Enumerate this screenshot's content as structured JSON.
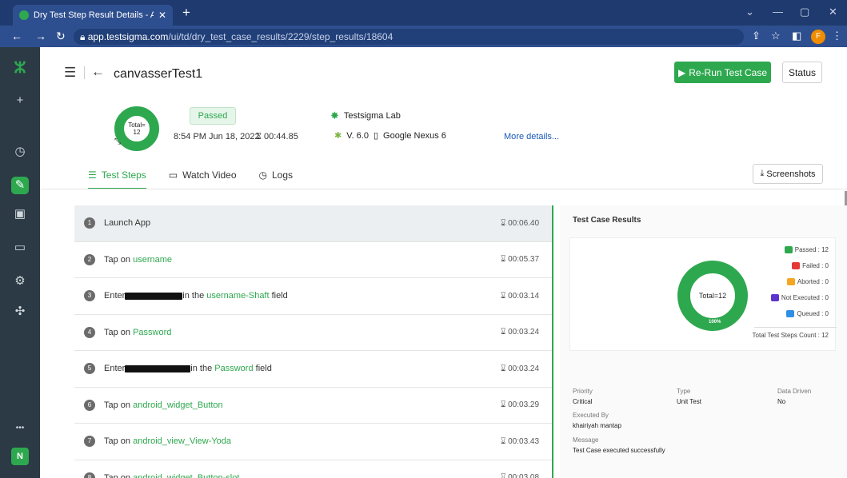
{
  "browser": {
    "tab_title": "Dry Test Step Result Details - AI F",
    "tab_close": "✕",
    "new_tab": "+",
    "url_host": "app.testsigma.com",
    "url_path": "/ui/td/dry_test_case_results/2229/step_results/18604",
    "profile_initial": "F"
  },
  "sidebar": {
    "logo": "ⵣ",
    "add": "+",
    "dashboard": "◷",
    "edit": "✎",
    "briefcase": "▣",
    "monitor": "▭",
    "settings": "⚙",
    "puzzle": "✣",
    "more": "•••",
    "user_initial": "N"
  },
  "header": {
    "title": "canvasserTest1",
    "rerun_label": "Re-Run Test Case",
    "status_label": "Status"
  },
  "summary": {
    "donut_total_label": "Total=",
    "donut_total_value": "12",
    "result_badge": "Passed",
    "run_datetime": "8:54 PM Jun 18, 2022",
    "run_duration": "00:44.85",
    "lab_name": "Testsigma Lab",
    "os_version": "V. 6.0",
    "device_name": "Google Nexus 6",
    "more_details": "More details..."
  },
  "tabs": {
    "test_steps": "Test Steps",
    "watch_video": "Watch Video",
    "logs": "Logs",
    "screenshots": "Screenshots"
  },
  "steps": [
    {
      "n": "1",
      "pre": "Launch App",
      "el": "",
      "post": "",
      "mask": 0,
      "dur": "00:06.40"
    },
    {
      "n": "2",
      "pre": "Tap on",
      "el": "username",
      "post": "",
      "mask": 0,
      "dur": "00:05.37"
    },
    {
      "n": "3",
      "pre": "Enter",
      "el": "username-Shaft",
      "post": "field",
      "mask": 72,
      "mid": "in the",
      "dur": "00:03.14"
    },
    {
      "n": "4",
      "pre": "Tap on",
      "el": "Password",
      "post": "",
      "mask": 0,
      "dur": "00:03.24"
    },
    {
      "n": "5",
      "pre": "Enter",
      "el": "Password",
      "post": "field",
      "mask": 82,
      "mid": "in the",
      "dur": "00:03.24"
    },
    {
      "n": "6",
      "pre": "Tap on",
      "el": "android_widget_Button",
      "post": "",
      "mask": 0,
      "dur": "00:03.29"
    },
    {
      "n": "7",
      "pre": "Tap on",
      "el": "android_view_View-Yoda",
      "post": "",
      "mask": 0,
      "dur": "00:03.43"
    },
    {
      "n": "8",
      "pre": "Tap on",
      "el": "android_widget_Button-slot",
      "post": "",
      "mask": 0,
      "dur": "00:03.08"
    }
  ],
  "results": {
    "title": "Test Case Results",
    "donut_label": "Total=12",
    "percent_label": "100%",
    "legend": [
      {
        "label": "Passed : 12",
        "color": "#2ea84f"
      },
      {
        "label": "Failed : 0",
        "color": "#e53935"
      },
      {
        "label": "Aborted : 0",
        "color": "#f5a623"
      },
      {
        "label": "Not Executed : 0",
        "color": "#5c35cc"
      },
      {
        "label": "Queued : 0",
        "color": "#2f8fe6"
      }
    ],
    "total_steps": "Total Test Steps Count : 12"
  },
  "chart_data": {
    "type": "pie",
    "title": "Test Case Results",
    "categories": [
      "Passed",
      "Failed",
      "Aborted",
      "Not Executed",
      "Queued"
    ],
    "values": [
      12,
      0,
      0,
      0,
      0
    ],
    "colors": [
      "#2ea84f",
      "#e53935",
      "#f5a623",
      "#5c35cc",
      "#2f8fe6"
    ]
  },
  "meta": {
    "priority_label": "Priority",
    "priority_value": "Critical",
    "type_label": "Type",
    "type_value": "Unit Test",
    "data_driven_label": "Data Driven",
    "data_driven_value": "No",
    "executed_by_label": "Executed By",
    "executed_by_value": "khairiyah mantap",
    "message_label": "Message",
    "message_value": "Test Case executed successfully"
  }
}
